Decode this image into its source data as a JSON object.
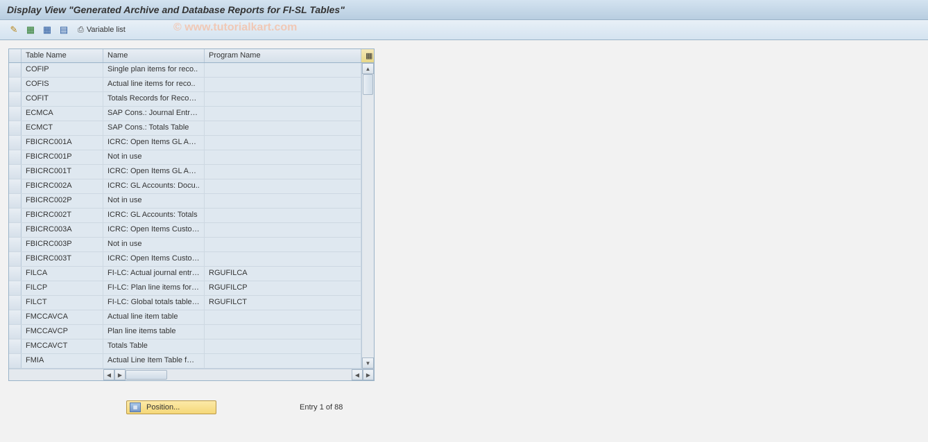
{
  "title": "Display View \"Generated Archive and Database Reports for FI-SL Tables\"",
  "toolbar": {
    "variable_list": "Variable list"
  },
  "watermark": "© www.tutorialkart.com",
  "columns": {
    "sel": "",
    "table_name": "Table Name",
    "name": "Name",
    "program_name": "Program Name"
  },
  "rows": [
    {
      "table": "COFIP",
      "name": "Single plan items for reco..",
      "prog": ""
    },
    {
      "table": "COFIS",
      "name": "Actual line items for reco..",
      "prog": ""
    },
    {
      "table": "COFIT",
      "name": "Totals Records for Recon…",
      "prog": ""
    },
    {
      "table": "ECMCA",
      "name": "SAP Cons.: Journal Entry…",
      "prog": ""
    },
    {
      "table": "ECMCT",
      "name": "SAP Cons.: Totals Table",
      "prog": ""
    },
    {
      "table": "FBICRC001A",
      "name": "ICRC: Open Items GL Ac…",
      "prog": ""
    },
    {
      "table": "FBICRC001P",
      "name": "Not in use",
      "prog": ""
    },
    {
      "table": "FBICRC001T",
      "name": "ICRC: Open Items GL Ac…",
      "prog": ""
    },
    {
      "table": "FBICRC002A",
      "name": "ICRC: GL Accounts: Docu..",
      "prog": ""
    },
    {
      "table": "FBICRC002P",
      "name": "Not in use",
      "prog": ""
    },
    {
      "table": "FBICRC002T",
      "name": "ICRC: GL Accounts: Totals",
      "prog": ""
    },
    {
      "table": "FBICRC003A",
      "name": "ICRC: Open Items Custo…",
      "prog": ""
    },
    {
      "table": "FBICRC003P",
      "name": "Not in use",
      "prog": ""
    },
    {
      "table": "FBICRC003T",
      "name": "ICRC: Open Items Custo…",
      "prog": ""
    },
    {
      "table": "FILCA",
      "name": "FI-LC: Actual journal entr…",
      "prog": "RGUFILCA"
    },
    {
      "table": "FILCP",
      "name": "FI-LC: Plan line items for …",
      "prog": "RGUFILCP"
    },
    {
      "table": "FILCT",
      "name": "FI-LC: Global totals table …",
      "prog": "RGUFILCT"
    },
    {
      "table": "FMCCAVCA",
      "name": "Actual line item table",
      "prog": ""
    },
    {
      "table": "FMCCAVCP",
      "name": "Plan line items table",
      "prog": ""
    },
    {
      "table": "FMCCAVCT",
      "name": "Totals Table",
      "prog": ""
    },
    {
      "table": "FMIA",
      "name": "Actual Line Item Table f…",
      "prog": ""
    }
  ],
  "footer": {
    "position": "Position...",
    "entry": "Entry 1 of 88"
  }
}
